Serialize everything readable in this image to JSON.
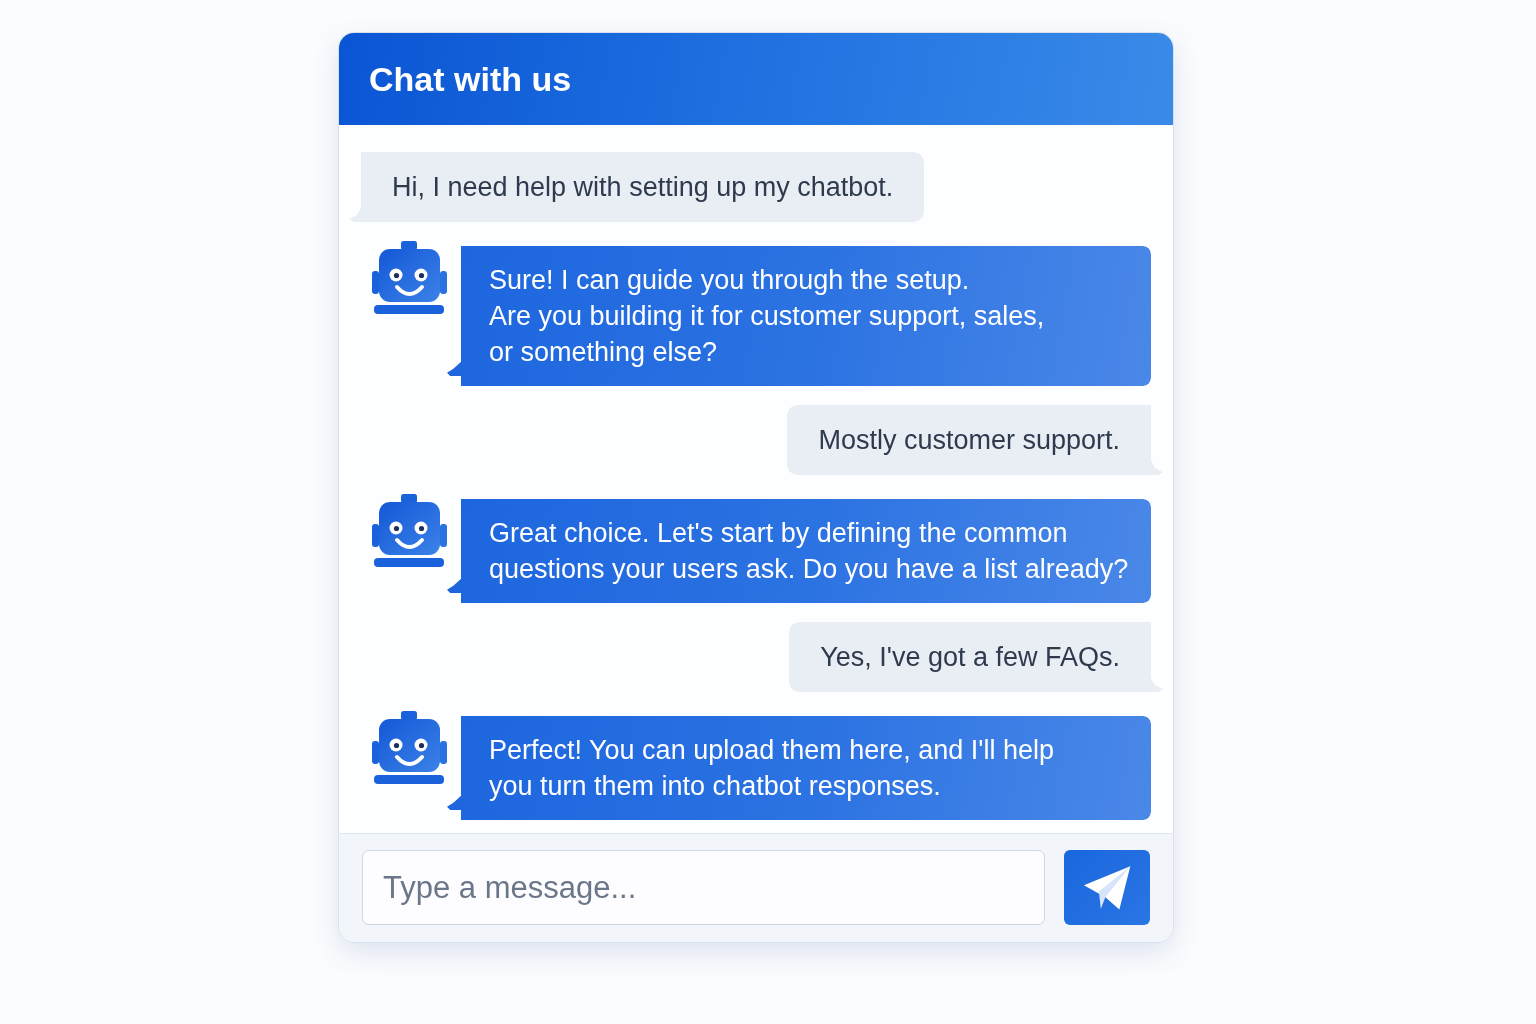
{
  "chat": {
    "title": "Chat with us"
  },
  "messages": [
    {
      "kind": "incoming",
      "text": "Hi, I need help with setting up my chatbot."
    },
    {
      "kind": "bot",
      "text": "Sure! I can guide you through the setup.\nAre you building it for customer support, sales,\nor something else?"
    },
    {
      "kind": "outgoing",
      "text": "Mostly customer support."
    },
    {
      "kind": "bot",
      "text": "Great choice. Let's start by defining the common\nquestions your users ask. Do you have a list already?"
    },
    {
      "kind": "outgoing",
      "text": "Yes, I've got a few FAQs."
    },
    {
      "kind": "bot",
      "text": "Perfect! You can upload them here, and I'll help\nyou turn them into chatbot responses."
    }
  ],
  "composer": {
    "placeholder": "Type a message..."
  }
}
